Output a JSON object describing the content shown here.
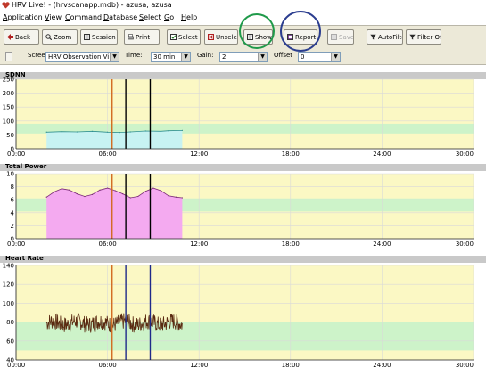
{
  "window": {
    "title": "HRV Live! - (hrvscanapp.mdb) - azusa, azusa"
  },
  "menu": [
    {
      "label": "Application",
      "key": "A",
      "rest": "pplication"
    },
    {
      "label": "View",
      "key": "V",
      "rest": "iew"
    },
    {
      "label": "Command",
      "key": "C",
      "rest": "ommand"
    },
    {
      "label": "Database",
      "key": "D",
      "rest": "atabase"
    },
    {
      "label": "Select",
      "key": "S",
      "rest": "elect"
    },
    {
      "label": "Go",
      "key": "G",
      "rest": "o"
    },
    {
      "label": "Help",
      "key": "H",
      "rest": "elp"
    }
  ],
  "toolbar": {
    "back": "Back",
    "zoom": "Zoom",
    "session": "Session",
    "print": "Print",
    "select": "Select",
    "unselect": "Unselec",
    "show": "Show",
    "report": "Report",
    "save": "Save",
    "autofilter": "AutoFilter",
    "filter_off": "Filter Off"
  },
  "selectors": {
    "screen_label": "Screen",
    "screen_value": "HRV Observation Vi",
    "time_label": "Time:",
    "time_value": "30 min",
    "gain_label": "Gain:",
    "gain_value": "2",
    "offset_label": "Offset",
    "offset_value": "0"
  },
  "annotations": {
    "show_circle_color": "#1f9a4a",
    "report_circle_color": "#2b3d8f"
  },
  "colors": {
    "band_yellow": "#fbf8c4",
    "band_green": "#cdf3c9",
    "sdnn_fill": "#c7f2f2",
    "tp_fill": "#f4aaf0",
    "hr_line": "#5a2a10"
  },
  "chart_data": [
    {
      "type": "area",
      "title": "SDNN",
      "ylim": [
        0,
        250
      ],
      "yticks": [
        "0",
        "50",
        "100",
        "150",
        "200",
        "250"
      ],
      "xticks": [
        "00:00",
        "06:00",
        "12:00",
        "18:00",
        "24:00",
        "30:00"
      ],
      "xlim": [
        0,
        30
      ],
      "green_band": [
        55,
        90
      ],
      "markers": [
        {
          "x": 6.3,
          "color": "#d2691e"
        },
        {
          "x": 7.2,
          "color": "#000000"
        },
        {
          "x": 8.8,
          "color": "#000000"
        }
      ],
      "x": [
        2.0,
        3.0,
        4.0,
        5.0,
        6.0,
        6.8,
        7.5,
        8.5,
        9.5,
        10.0,
        10.9
      ],
      "values": [
        60,
        62,
        61,
        63,
        60,
        59,
        61,
        64,
        63,
        65,
        66
      ]
    },
    {
      "type": "area",
      "title": "Total Power",
      "ylim": [
        0,
        10
      ],
      "yticks": [
        "0",
        "2",
        "4",
        "6",
        "8",
        "10"
      ],
      "xticks": [
        "00:00",
        "06:00",
        "12:00",
        "18:00",
        "24:00",
        "30:00"
      ],
      "xlim": [
        0,
        30
      ],
      "green_band": [
        4.2,
        6.2
      ],
      "markers": [
        {
          "x": 6.3,
          "color": "#d2691e"
        },
        {
          "x": 7.2,
          "color": "#000000"
        },
        {
          "x": 8.8,
          "color": "#000000"
        }
      ],
      "x": [
        2.0,
        2.5,
        3.0,
        3.5,
        4.0,
        4.5,
        5.0,
        5.5,
        6.0,
        6.5,
        7.0,
        7.5,
        8.0,
        8.5,
        9.0,
        9.5,
        10.0,
        10.5,
        10.9
      ],
      "values": [
        6.4,
        7.2,
        7.7,
        7.5,
        6.9,
        6.5,
        6.8,
        7.5,
        7.8,
        7.4,
        6.9,
        6.3,
        6.5,
        7.3,
        7.8,
        7.4,
        6.6,
        6.4,
        6.3
      ]
    },
    {
      "type": "line",
      "title": "Heart Rate",
      "ylim": [
        40,
        140
      ],
      "yticks": [
        "40",
        "60",
        "80",
        "100",
        "120",
        "140"
      ],
      "xticks": [
        "00:00",
        "06:00",
        "12:00",
        "18:00",
        "24:00",
        "30:00"
      ],
      "xlim": [
        0,
        30
      ],
      "green_band": [
        50,
        80
      ],
      "markers": [
        {
          "x": 6.3,
          "color": "#d2691e"
        },
        {
          "x": 7.2,
          "color": "#1f2a8a"
        },
        {
          "x": 8.8,
          "color": "#1f2a8a"
        }
      ],
      "x_start": 2.0,
      "x_end": 10.9,
      "mean": 79,
      "spread": 9
    }
  ]
}
